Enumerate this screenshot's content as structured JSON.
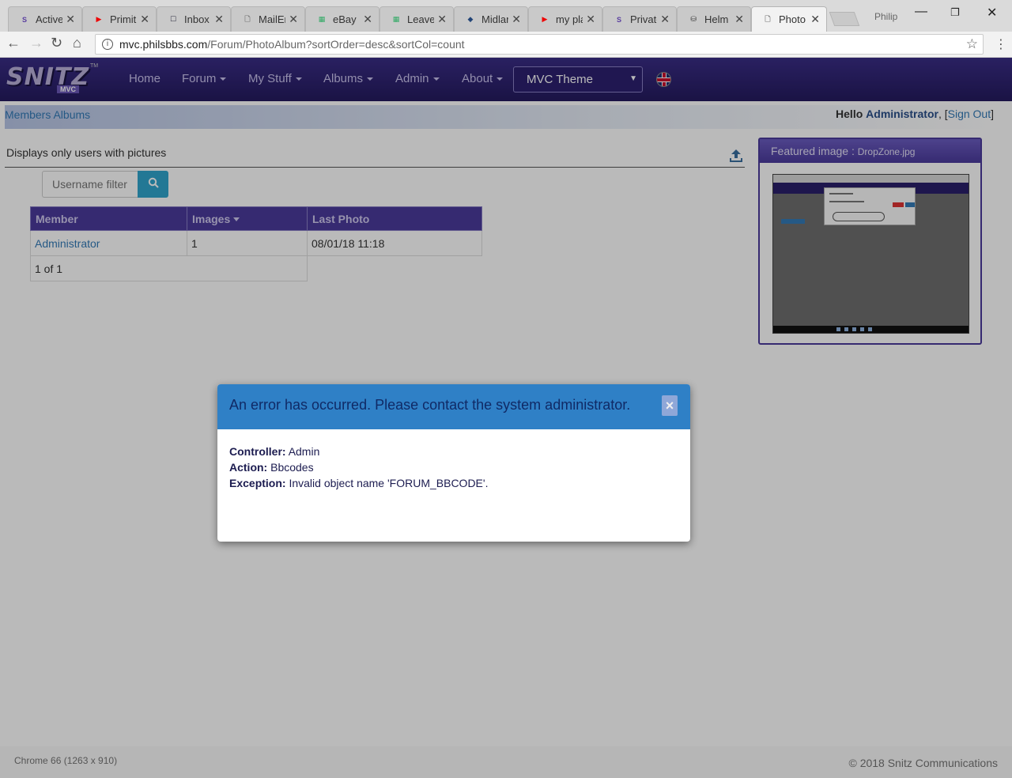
{
  "browser": {
    "tabs": [
      {
        "favicon": "S",
        "label": "Active",
        "favicon_color": "#5a3ea0"
      },
      {
        "favicon": "▶",
        "label": "Primiti",
        "favicon_color": "#e00"
      },
      {
        "favicon": "☐",
        "label": "Inbox",
        "favicon_color": "#334"
      },
      {
        "favicon": "🗋",
        "label": "MailEn",
        "favicon_color": "#777"
      },
      {
        "favicon": "▦",
        "label": "eBay F",
        "favicon_color": "#3a6"
      },
      {
        "favicon": "▦",
        "label": "Leave",
        "favicon_color": "#3a6"
      },
      {
        "favicon": "◆",
        "label": "Midlar",
        "favicon_color": "#247"
      },
      {
        "favicon": "▶",
        "label": "my pla",
        "favicon_color": "#e00"
      },
      {
        "favicon": "S",
        "label": "Private",
        "favicon_color": "#5a3ea0"
      },
      {
        "favicon": "⛁",
        "label": "Helm",
        "favicon_color": "#333"
      },
      {
        "favicon": "🗋",
        "label": "Photo",
        "favicon_color": "#777"
      }
    ],
    "profile_name": "Philip",
    "url_host": "mvc.philsbbs.com",
    "url_path": "/Forum/PhotoAlbum?sortOrder=desc&sortCol=count"
  },
  "site": {
    "logo_text": "SNITZ",
    "logo_sub": "MVC",
    "logo_tm": "TM",
    "nav": [
      {
        "label": "Home",
        "dropdown": false
      },
      {
        "label": "Forum",
        "dropdown": true
      },
      {
        "label": "My Stuff",
        "dropdown": true
      },
      {
        "label": "Albums",
        "dropdown": true
      },
      {
        "label": "Admin",
        "dropdown": true
      },
      {
        "label": "About",
        "dropdown": true
      }
    ],
    "theme_select": "MVC Theme",
    "language_icon": "uk-flag-icon"
  },
  "breadcrumb": "Members Albums",
  "greeting": {
    "hello": "Hello",
    "user": "Administrator",
    "separator": ", [",
    "signout": "Sign Out",
    "close": "]"
  },
  "main": {
    "subtitle": "Displays only users with pictures",
    "search_placeholder": "Username filter",
    "table": {
      "headers": [
        "Member",
        "Images",
        "Last Photo"
      ],
      "rows": [
        {
          "member": "Administrator",
          "images": "1",
          "last_photo": "08/01/18 11:18"
        }
      ],
      "pager": "1 of 1"
    }
  },
  "featured": {
    "label": "Featured image : ",
    "filename": "DropZone.jpg"
  },
  "modal": {
    "title": "An error has occurred. Please contact the system administrator.",
    "close": "×",
    "controller_label": "Controller:",
    "controller_value": "Admin",
    "action_label": "Action:",
    "action_value": "Bbcodes",
    "exception_label": "Exception:",
    "exception_value": "Invalid object name 'FORUM_BBCODE'."
  },
  "footer": {
    "browser_info": "Chrome 66 (1263 x 910)",
    "copyright": "© 2018 Snitz Communications"
  },
  "colors": {
    "navbar": "#2c2070",
    "table_header": "#4a3a9c",
    "modal_header": "#2f80c6",
    "search_button": "#31a5cc"
  }
}
